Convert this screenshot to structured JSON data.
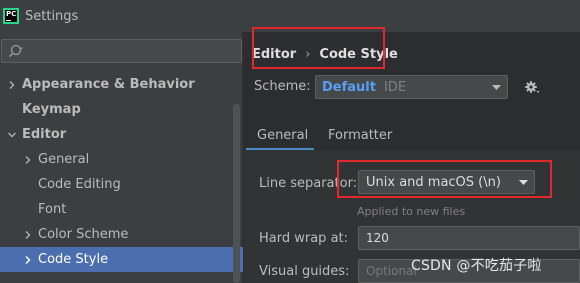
{
  "window": {
    "title": "Settings",
    "logo_text": "PC"
  },
  "sidebar": {
    "search_placeholder": "",
    "items": [
      {
        "label": "Appearance & Behavior",
        "bold": true,
        "arrow": "right"
      },
      {
        "label": "Keymap",
        "bold": true,
        "arrow": "none"
      },
      {
        "label": "Editor",
        "bold": true,
        "arrow": "down"
      },
      {
        "label": "General",
        "bold": false,
        "arrow": "right"
      },
      {
        "label": "Code Editing",
        "bold": false,
        "arrow": "none"
      },
      {
        "label": "Font",
        "bold": false,
        "arrow": "none"
      },
      {
        "label": "Color Scheme",
        "bold": false,
        "arrow": "right"
      },
      {
        "label": "Code Style",
        "bold": false,
        "arrow": "down",
        "selected": true
      }
    ]
  },
  "breadcrumb": {
    "part1": "Editor",
    "separator": "›",
    "part2": "Code Style"
  },
  "scheme": {
    "label": "Scheme:",
    "value": "Default",
    "sub": "IDE"
  },
  "tabs": [
    {
      "label": "General",
      "active": true
    },
    {
      "label": "Formatter",
      "active": false
    }
  ],
  "general": {
    "line_separator_label": "Line separator:",
    "line_separator_value": "Unix and macOS (\\n)",
    "line_separator_hint": "Applied to new files",
    "hard_wrap_label": "Hard wrap at:",
    "hard_wrap_value": "120",
    "visual_guides_label": "Visual guides:",
    "visual_guides_placeholder": "Optional"
  },
  "watermark": "CSDN @不吃茄子啦",
  "colors": {
    "accent": "#4b6eaf",
    "highlight": "#e0282e",
    "link": "#589df6",
    "tab_underline": "#4a88c7"
  }
}
